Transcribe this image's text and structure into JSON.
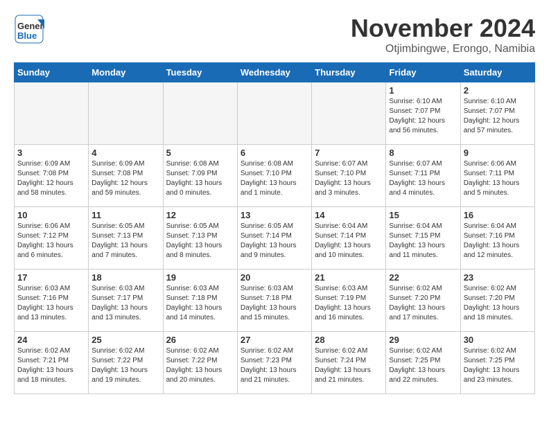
{
  "header": {
    "logo_line1": "General",
    "logo_line2": "Blue",
    "month": "November 2024",
    "location": "Otjimbingwe, Erongo, Namibia"
  },
  "weekdays": [
    "Sunday",
    "Monday",
    "Tuesday",
    "Wednesday",
    "Thursday",
    "Friday",
    "Saturday"
  ],
  "weeks": [
    [
      {
        "day": "",
        "info": "",
        "empty": true
      },
      {
        "day": "",
        "info": "",
        "empty": true
      },
      {
        "day": "",
        "info": "",
        "empty": true
      },
      {
        "day": "",
        "info": "",
        "empty": true
      },
      {
        "day": "",
        "info": "",
        "empty": true
      },
      {
        "day": "1",
        "info": "Sunrise: 6:10 AM\nSunset: 7:07 PM\nDaylight: 12 hours\nand 56 minutes.",
        "empty": false
      },
      {
        "day": "2",
        "info": "Sunrise: 6:10 AM\nSunset: 7:07 PM\nDaylight: 12 hours\nand 57 minutes.",
        "empty": false
      }
    ],
    [
      {
        "day": "3",
        "info": "Sunrise: 6:09 AM\nSunset: 7:08 PM\nDaylight: 12 hours\nand 58 minutes.",
        "empty": false
      },
      {
        "day": "4",
        "info": "Sunrise: 6:09 AM\nSunset: 7:08 PM\nDaylight: 12 hours\nand 59 minutes.",
        "empty": false
      },
      {
        "day": "5",
        "info": "Sunrise: 6:08 AM\nSunset: 7:09 PM\nDaylight: 13 hours\nand 0 minutes.",
        "empty": false
      },
      {
        "day": "6",
        "info": "Sunrise: 6:08 AM\nSunset: 7:10 PM\nDaylight: 13 hours\nand 1 minute.",
        "empty": false
      },
      {
        "day": "7",
        "info": "Sunrise: 6:07 AM\nSunset: 7:10 PM\nDaylight: 13 hours\nand 3 minutes.",
        "empty": false
      },
      {
        "day": "8",
        "info": "Sunrise: 6:07 AM\nSunset: 7:11 PM\nDaylight: 13 hours\nand 4 minutes.",
        "empty": false
      },
      {
        "day": "9",
        "info": "Sunrise: 6:06 AM\nSunset: 7:11 PM\nDaylight: 13 hours\nand 5 minutes.",
        "empty": false
      }
    ],
    [
      {
        "day": "10",
        "info": "Sunrise: 6:06 AM\nSunset: 7:12 PM\nDaylight: 13 hours\nand 6 minutes.",
        "empty": false
      },
      {
        "day": "11",
        "info": "Sunrise: 6:05 AM\nSunset: 7:13 PM\nDaylight: 13 hours\nand 7 minutes.",
        "empty": false
      },
      {
        "day": "12",
        "info": "Sunrise: 6:05 AM\nSunset: 7:13 PM\nDaylight: 13 hours\nand 8 minutes.",
        "empty": false
      },
      {
        "day": "13",
        "info": "Sunrise: 6:05 AM\nSunset: 7:14 PM\nDaylight: 13 hours\nand 9 minutes.",
        "empty": false
      },
      {
        "day": "14",
        "info": "Sunrise: 6:04 AM\nSunset: 7:14 PM\nDaylight: 13 hours\nand 10 minutes.",
        "empty": false
      },
      {
        "day": "15",
        "info": "Sunrise: 6:04 AM\nSunset: 7:15 PM\nDaylight: 13 hours\nand 11 minutes.",
        "empty": false
      },
      {
        "day": "16",
        "info": "Sunrise: 6:04 AM\nSunset: 7:16 PM\nDaylight: 13 hours\nand 12 minutes.",
        "empty": false
      }
    ],
    [
      {
        "day": "17",
        "info": "Sunrise: 6:03 AM\nSunset: 7:16 PM\nDaylight: 13 hours\nand 13 minutes.",
        "empty": false
      },
      {
        "day": "18",
        "info": "Sunrise: 6:03 AM\nSunset: 7:17 PM\nDaylight: 13 hours\nand 13 minutes.",
        "empty": false
      },
      {
        "day": "19",
        "info": "Sunrise: 6:03 AM\nSunset: 7:18 PM\nDaylight: 13 hours\nand 14 minutes.",
        "empty": false
      },
      {
        "day": "20",
        "info": "Sunrise: 6:03 AM\nSunset: 7:18 PM\nDaylight: 13 hours\nand 15 minutes.",
        "empty": false
      },
      {
        "day": "21",
        "info": "Sunrise: 6:03 AM\nSunset: 7:19 PM\nDaylight: 13 hours\nand 16 minutes.",
        "empty": false
      },
      {
        "day": "22",
        "info": "Sunrise: 6:02 AM\nSunset: 7:20 PM\nDaylight: 13 hours\nand 17 minutes.",
        "empty": false
      },
      {
        "day": "23",
        "info": "Sunrise: 6:02 AM\nSunset: 7:20 PM\nDaylight: 13 hours\nand 18 minutes.",
        "empty": false
      }
    ],
    [
      {
        "day": "24",
        "info": "Sunrise: 6:02 AM\nSunset: 7:21 PM\nDaylight: 13 hours\nand 18 minutes.",
        "empty": false
      },
      {
        "day": "25",
        "info": "Sunrise: 6:02 AM\nSunset: 7:22 PM\nDaylight: 13 hours\nand 19 minutes.",
        "empty": false
      },
      {
        "day": "26",
        "info": "Sunrise: 6:02 AM\nSunset: 7:22 PM\nDaylight: 13 hours\nand 20 minutes.",
        "empty": false
      },
      {
        "day": "27",
        "info": "Sunrise: 6:02 AM\nSunset: 7:23 PM\nDaylight: 13 hours\nand 21 minutes.",
        "empty": false
      },
      {
        "day": "28",
        "info": "Sunrise: 6:02 AM\nSunset: 7:24 PM\nDaylight: 13 hours\nand 21 minutes.",
        "empty": false
      },
      {
        "day": "29",
        "info": "Sunrise: 6:02 AM\nSunset: 7:25 PM\nDaylight: 13 hours\nand 22 minutes.",
        "empty": false
      },
      {
        "day": "30",
        "info": "Sunrise: 6:02 AM\nSunset: 7:25 PM\nDaylight: 13 hours\nand 23 minutes.",
        "empty": false
      }
    ]
  ]
}
